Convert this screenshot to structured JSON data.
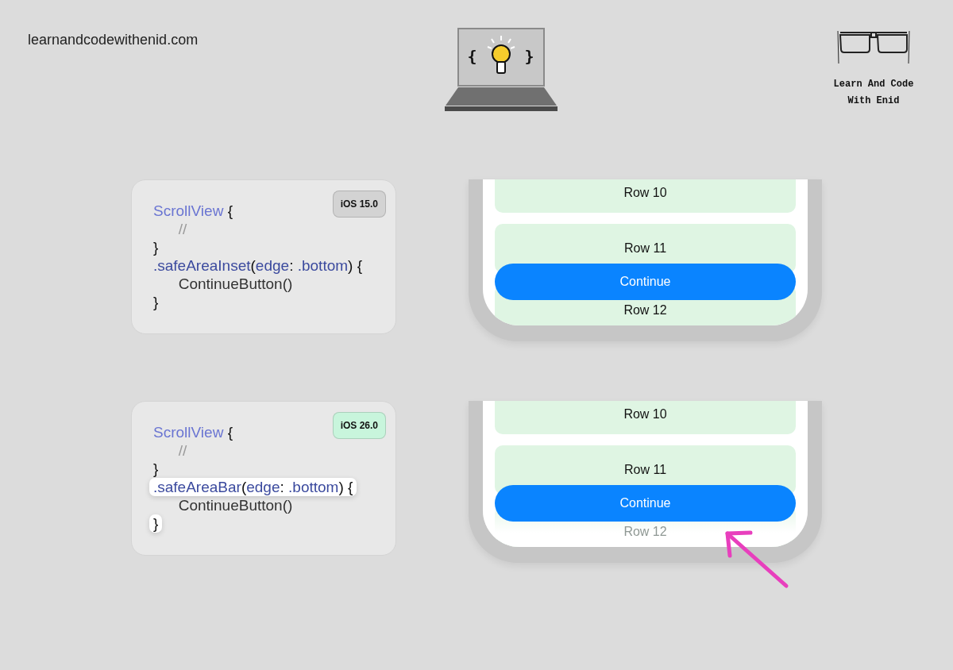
{
  "site": "learnandcodewithenid.com",
  "logo": {
    "braces": [
      "{",
      "}"
    ],
    "name_lines": [
      "Learn And Code",
      "With Enid"
    ]
  },
  "sections": [
    {
      "badge": {
        "label": "iOS 15.0",
        "color": "#d3d3d3"
      },
      "code": [
        {
          "highlighted": false,
          "tokens": [
            {
              "text": "ScrollView",
              "kind": "type"
            },
            {
              "text": " {",
              "kind": "plain"
            }
          ]
        },
        {
          "highlighted": false,
          "tokens": [
            {
              "text": "      //",
              "kind": "comment"
            }
          ]
        },
        {
          "highlighted": false,
          "tokens": [
            {
              "text": "}",
              "kind": "plain"
            }
          ]
        },
        {
          "highlighted": false,
          "tokens": [
            {
              "text": ".safeAreaInset",
              "kind": "member"
            },
            {
              "text": "(",
              "kind": "plain"
            },
            {
              "text": "edge",
              "kind": "member"
            },
            {
              "text": ": ",
              "kind": "plain"
            },
            {
              "text": ".bottom",
              "kind": "member"
            },
            {
              "text": ") {",
              "kind": "plain"
            }
          ]
        },
        {
          "highlighted": false,
          "tokens": [
            {
              "text": "      ContinueButton()",
              "kind": "call"
            }
          ]
        },
        {
          "highlighted": false,
          "tokens": [
            {
              "text": "}",
              "kind": "plain"
            }
          ]
        }
      ],
      "phone": {
        "kind": "inset",
        "rows": [
          "Row 10",
          "Row 11",
          "Row 12"
        ],
        "button": "Continue"
      }
    },
    {
      "badge": {
        "label": "iOS 26.0",
        "color": "#c8f5dc"
      },
      "code": [
        {
          "highlighted": false,
          "tokens": [
            {
              "text": "ScrollView",
              "kind": "type"
            },
            {
              "text": " {",
              "kind": "plain"
            }
          ]
        },
        {
          "highlighted": false,
          "tokens": [
            {
              "text": "      //",
              "kind": "comment"
            }
          ]
        },
        {
          "highlighted": false,
          "tokens": [
            {
              "text": "}",
              "kind": "plain"
            }
          ]
        },
        {
          "highlighted": true,
          "tokens": [
            {
              "text": ".safeAreaBar",
              "kind": "member"
            },
            {
              "text": "(",
              "kind": "plain"
            },
            {
              "text": "edge",
              "kind": "member"
            },
            {
              "text": ": ",
              "kind": "plain"
            },
            {
              "text": ".bottom",
              "kind": "member"
            },
            {
              "text": ") {",
              "kind": "plain"
            }
          ]
        },
        {
          "highlighted": false,
          "tokens": [
            {
              "text": "      ContinueButton()",
              "kind": "call"
            }
          ]
        },
        {
          "highlighted": true,
          "tokens": [
            {
              "text": "}",
              "kind": "plain"
            }
          ]
        }
      ],
      "phone": {
        "kind": "bar",
        "rows": [
          "Row 10",
          "Row 11",
          "Row 12"
        ],
        "button": "Continue"
      }
    }
  ]
}
